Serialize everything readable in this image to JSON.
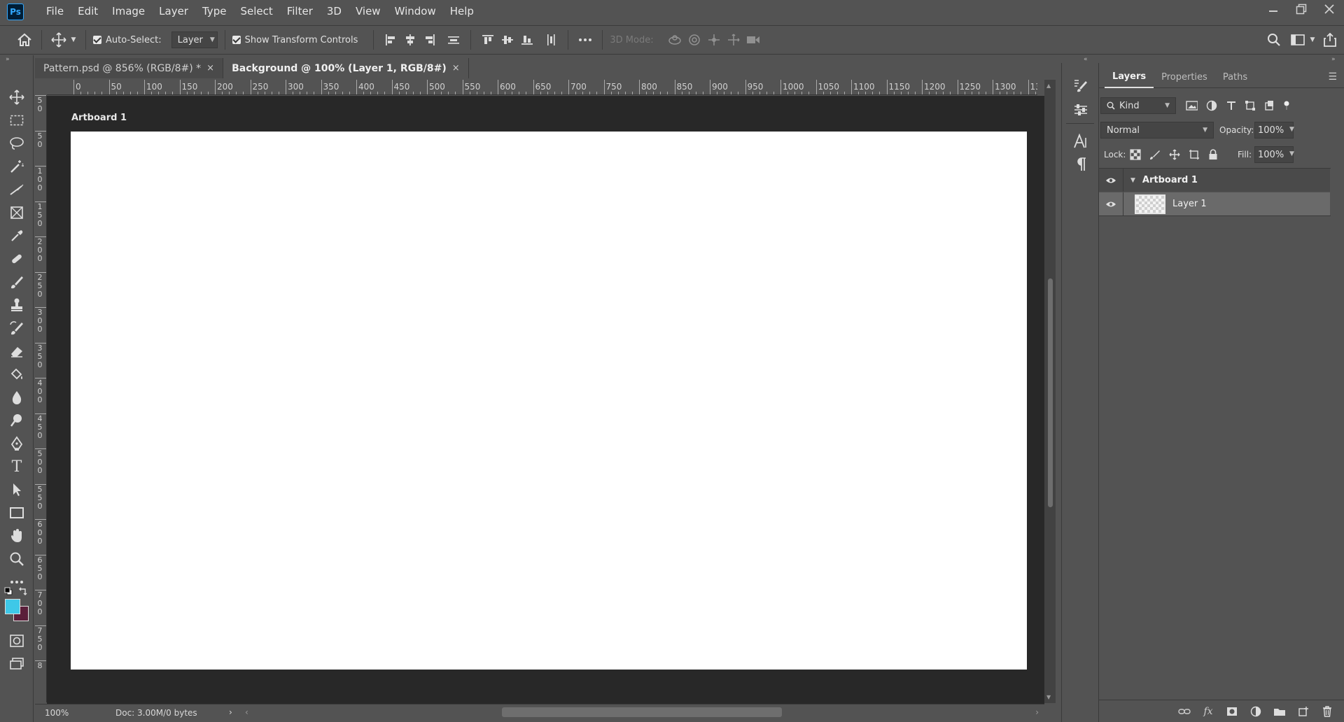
{
  "app": {
    "logo_text": "Ps"
  },
  "menu": [
    "File",
    "Edit",
    "Image",
    "Layer",
    "Type",
    "Select",
    "Filter",
    "3D",
    "View",
    "Window",
    "Help"
  ],
  "options_bar": {
    "auto_select_label": "Auto-Select:",
    "auto_select_value": "Layer",
    "show_transform_label": "Show Transform Controls",
    "mode_3d_label": "3D Mode:"
  },
  "tabs": [
    {
      "label": "Pattern.psd @ 856% (RGB/8#) *",
      "active": false
    },
    {
      "label": "Background @ 100% (Layer 1, RGB/8#)",
      "active": true
    }
  ],
  "tab_close_glyph": "×",
  "ruler_top": [
    "0",
    "50",
    "100",
    "150",
    "200",
    "250",
    "300",
    "350",
    "400",
    "450",
    "500",
    "550",
    "600",
    "650",
    "700",
    "750",
    "800",
    "850",
    "900",
    "950",
    "1000",
    "1050",
    "1100",
    "1150",
    "1200",
    "1250",
    "1300",
    "1350"
  ],
  "ruler_left": [
    "5\n0",
    "5\n0",
    "1\n0\n0",
    "1\n5\n0",
    "2\n0\n0",
    "2\n5\n0",
    "3\n0\n0",
    "3\n5\n0",
    "4\n0\n0",
    "4\n5\n0",
    "5\n0\n0",
    "5\n5\n0",
    "6\n0\n0",
    "6\n5\n0",
    "7\n0\n0",
    "7\n5\n0",
    "8"
  ],
  "artboard": {
    "label": "Artboard 1"
  },
  "status": {
    "zoom": "100%",
    "doc": "Doc: 3.00M/0 bytes"
  },
  "colors": {
    "foreground": "#3ec8e8",
    "background": "#5a1f3a"
  },
  "panel": {
    "tabs": [
      "Layers",
      "Properties",
      "Paths"
    ],
    "filter_kind": "Kind",
    "blend_mode": "Normal",
    "opacity_label": "Opacity:",
    "opacity_value": "100%",
    "lock_label": "Lock:",
    "fill_label": "Fill:",
    "fill_value": "100%",
    "layers": [
      {
        "name": "Artboard 1",
        "type": "artboard"
      },
      {
        "name": "Layer 1",
        "type": "layer",
        "selected": true
      }
    ]
  }
}
